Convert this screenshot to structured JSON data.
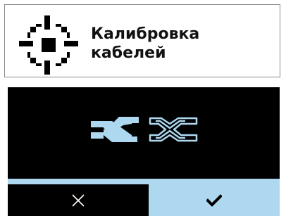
{
  "header": {
    "title_line1": "Калибровка",
    "title_line2": "кабелей",
    "icon": "target-crosshair-icon"
  },
  "screen": {
    "icon": "cable-calibration-icon"
  },
  "buttons": {
    "cancel_icon": "close-icon",
    "confirm_icon": "checkmark-icon"
  },
  "colors": {
    "accent": "#add8f0",
    "screen_background": "#000000",
    "text": "#111111"
  }
}
